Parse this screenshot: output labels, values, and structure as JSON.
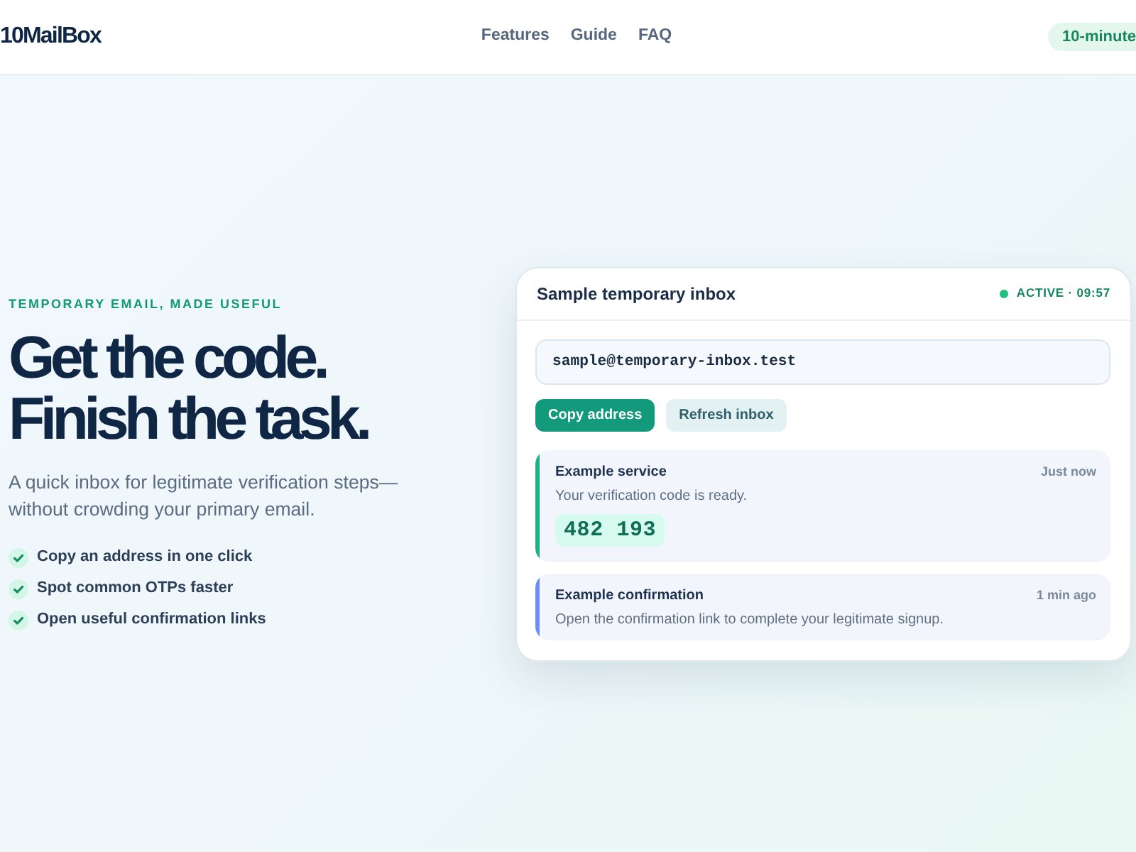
{
  "header": {
    "logo": "10MailBox",
    "nav": [
      "Features",
      "Guide",
      "FAQ"
    ],
    "badge": "10-minute"
  },
  "hero": {
    "eyebrow": "TEMPORARY EMAIL, MADE USEFUL",
    "headline": [
      "Get the code.",
      "Finish the task."
    ],
    "subtitle": "A quick inbox for legitimate verification steps—without crowding your primary email.",
    "features": [
      "Copy an address in one click",
      "Spot common OTPs faster",
      "Open useful confirmation links"
    ]
  },
  "inbox": {
    "title": "Sample temporary inbox",
    "status": "ACTIVE · 09:57",
    "address": {
      "value": "sample@temporary-inbox.test"
    },
    "buttons": [
      {
        "label": "Copy address",
        "kind": "primary"
      },
      {
        "label": "Refresh inbox",
        "kind": "secondary"
      }
    ],
    "messages": [
      {
        "sender": "Example service",
        "time": "Just now",
        "text": "Your verification code is ready.",
        "code": "482 193",
        "color": "#1fb08a"
      },
      {
        "sender": "Example confirmation",
        "time": "1 min ago",
        "text": "Open the confirmation link to complete your legitimate signup.",
        "color": "#6e8ff0"
      }
    ]
  }
}
